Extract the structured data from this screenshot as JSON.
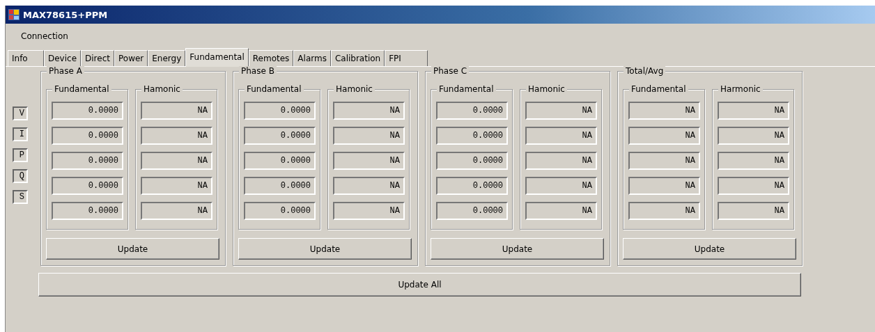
{
  "window": {
    "title": "MAX78615+PPM"
  },
  "menu": [
    "Connection"
  ],
  "tabs": [
    {
      "label": "Info",
      "selected": false
    },
    {
      "label": "Device",
      "selected": false
    },
    {
      "label": "Direct",
      "selected": false
    },
    {
      "label": "Power",
      "selected": false
    },
    {
      "label": "Energy",
      "selected": false
    },
    {
      "label": "Fundamental",
      "selected": true
    },
    {
      "label": "Remotes",
      "selected": false
    },
    {
      "label": "Alarms",
      "selected": false
    },
    {
      "label": "Calibration",
      "selected": false
    },
    {
      "label": "FPI",
      "selected": false
    }
  ],
  "row_labels": [
    "V",
    "I",
    "P",
    "Q",
    "S"
  ],
  "groups": [
    {
      "title": "Phase A",
      "columns": [
        {
          "title": "Fundamental",
          "values": [
            "0.0000",
            "0.0000",
            "0.0000",
            "0.0000",
            "0.0000"
          ]
        },
        {
          "title": "Hamonic",
          "values": [
            "NA",
            "NA",
            "NA",
            "NA",
            "NA"
          ]
        }
      ],
      "button": "Update"
    },
    {
      "title": "Phase B",
      "columns": [
        {
          "title": "Fundamental",
          "values": [
            "0.0000",
            "0.0000",
            "0.0000",
            "0.0000",
            "0.0000"
          ]
        },
        {
          "title": "Hamonic",
          "values": [
            "NA",
            "NA",
            "NA",
            "NA",
            "NA"
          ]
        }
      ],
      "button": "Update"
    },
    {
      "title": "Phase C",
      "columns": [
        {
          "title": "Fundamental",
          "values": [
            "0.0000",
            "0.0000",
            "0.0000",
            "0.0000",
            "0.0000"
          ]
        },
        {
          "title": "Hamonic",
          "values": [
            "NA",
            "NA",
            "NA",
            "NA",
            "NA"
          ]
        }
      ],
      "button": "Update"
    },
    {
      "title": "Total/Avg",
      "columns": [
        {
          "title": "Fundamental",
          "values": [
            "NA",
            "NA",
            "NA",
            "NA",
            "NA"
          ]
        },
        {
          "title": "Harmonic",
          "values": [
            "NA",
            "NA",
            "NA",
            "NA",
            "NA"
          ]
        }
      ],
      "button": "Update"
    }
  ],
  "update_all": "Update All"
}
